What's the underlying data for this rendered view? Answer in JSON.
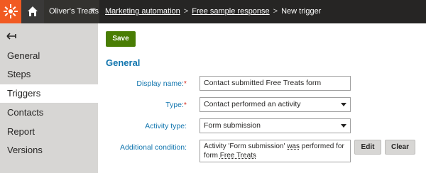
{
  "header": {
    "site_name": "Oliver's Treats",
    "breadcrumb": [
      "Marketing automation",
      "Free sample response",
      "New trigger"
    ],
    "colors": {
      "bar": "#262524",
      "logo": "#f15a22"
    }
  },
  "sidebar": {
    "items": [
      {
        "label": "General",
        "active": false
      },
      {
        "label": "Steps",
        "active": false
      },
      {
        "label": "Triggers",
        "active": true
      },
      {
        "label": "Contacts",
        "active": false
      },
      {
        "label": "Report",
        "active": false
      },
      {
        "label": "Versions",
        "active": false
      }
    ]
  },
  "main": {
    "save_label": "Save",
    "section_title": "General",
    "fields": {
      "display_name": {
        "label": "Display name:",
        "value": "Contact submitted Free Treats form"
      },
      "type": {
        "label": "Type:",
        "value": "Contact performed an activity"
      },
      "activity_type": {
        "label": "Activity type:",
        "value": "Form submission"
      },
      "additional_condition": {
        "label": "Additional condition:",
        "line1_a": "Activity '",
        "line1_b": "Form submission",
        "line1_c": "' ",
        "line1_d": "was",
        "line1_e": " performed for",
        "line2_a": "form ",
        "line2_b": "Free Treats"
      }
    },
    "edit_label": "Edit",
    "clear_label": "Clear",
    "required_mark": "*"
  }
}
